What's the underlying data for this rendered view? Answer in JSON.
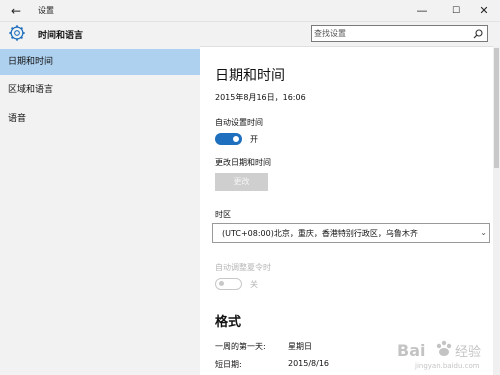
{
  "window": {
    "title": "设置",
    "back_glyph": "←",
    "minimize_glyph": "—",
    "maximize_glyph": "☐",
    "close_glyph": "✕"
  },
  "sidebar": {
    "header": "时间和语言",
    "items": [
      {
        "label": "日期和时间",
        "active": true
      },
      {
        "label": "区域和语言",
        "active": false
      },
      {
        "label": "语音",
        "active": false
      }
    ]
  },
  "search": {
    "placeholder": "查找设置"
  },
  "main": {
    "title": "日期和时间",
    "current_datetime": "2015年8月16日，16:06",
    "auto_time": {
      "label": "自动设置时间",
      "state": "开",
      "on": true
    },
    "change_datetime": {
      "label": "更改日期和时间",
      "button": "更改"
    },
    "timezone": {
      "label": "时区",
      "value": "(UTC+08:00)北京，重庆，香港特别行政区，乌鲁木齐"
    },
    "dst": {
      "label": "自动调整夏令时",
      "state": "关",
      "on": false
    },
    "formats": {
      "title": "格式",
      "rows": [
        {
          "label": "一周的第一天:",
          "value": "星期日"
        },
        {
          "label": "短日期:",
          "value": "2015/8/16"
        }
      ]
    }
  },
  "watermark": {
    "text": "Bai 经验",
    "sub": "jingyan.baidu.com"
  },
  "colors": {
    "accent": "#1e6fbd",
    "nav_active": "#aed1f0",
    "disabled": "#b5b5b5"
  }
}
